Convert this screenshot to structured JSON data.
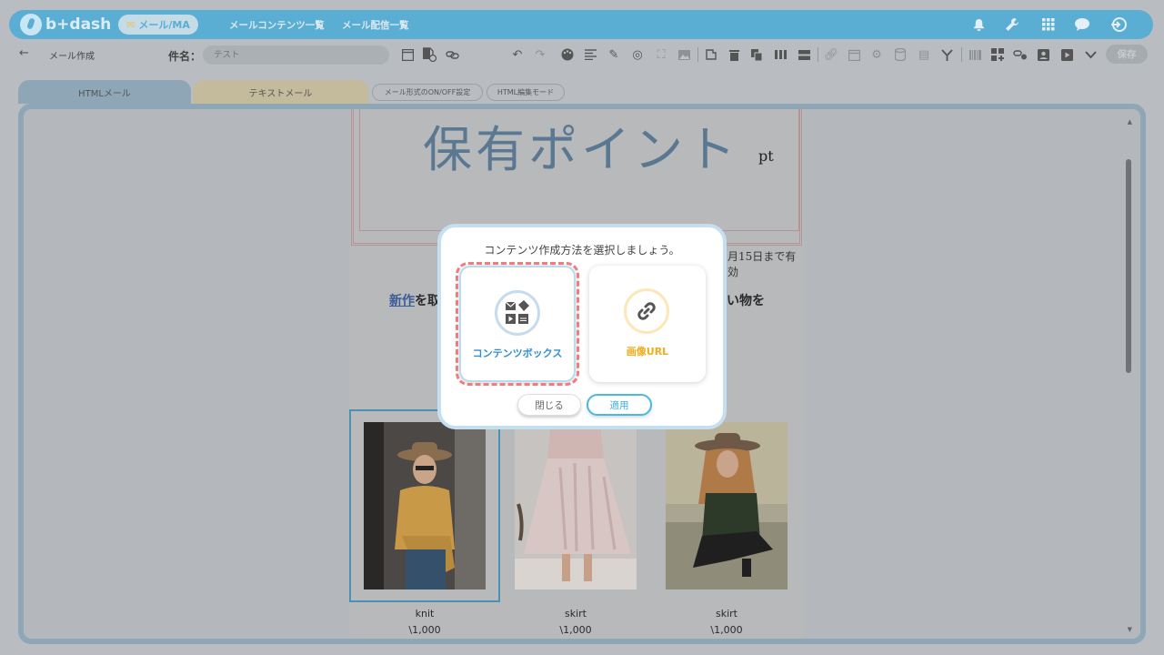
{
  "header": {
    "logo_text": "b+dash",
    "mail_ma_label": "メール/MA",
    "nav": [
      "メールコンテンツ一覧",
      "メール配信一覧"
    ],
    "icons": [
      "bell-icon",
      "wrench-icon",
      "grid-icon",
      "chat-icon",
      "logout-icon"
    ]
  },
  "toolbar": {
    "back_icon": "←",
    "title": "メール作成",
    "subject_label": "件名：",
    "subject_value": "テスト",
    "save_label": "保存"
  },
  "tabs": {
    "html": "HTMLメール",
    "text": "テキストメール",
    "onoff": "メール形式のON/OFF設定",
    "html_edit": "HTML編集モード"
  },
  "email": {
    "points_title": "保有ポイント",
    "points_unit": "pt",
    "expiry_text": "月15日まで有効",
    "headline_link": "新作",
    "headline_text": "を取",
    "headline_tail": "い物を",
    "products": [
      {
        "name": "knit",
        "price": "\\1,000"
      },
      {
        "name": "skirt",
        "price": "\\1,000"
      },
      {
        "name": "skirt",
        "price": "\\1,000"
      }
    ]
  },
  "modal": {
    "title": "コンテンツ作成方法を選択しましょう。",
    "option_contents": "コンテンツボックス",
    "option_url": "画像URL",
    "close_label": "閉じる",
    "apply_label": "適用"
  },
  "colors": {
    "header_blue": "#5aaed4",
    "accent_blue": "#2f8fd0",
    "accent_orange": "#f0ad1c",
    "highlight_red": "#f07c80"
  }
}
